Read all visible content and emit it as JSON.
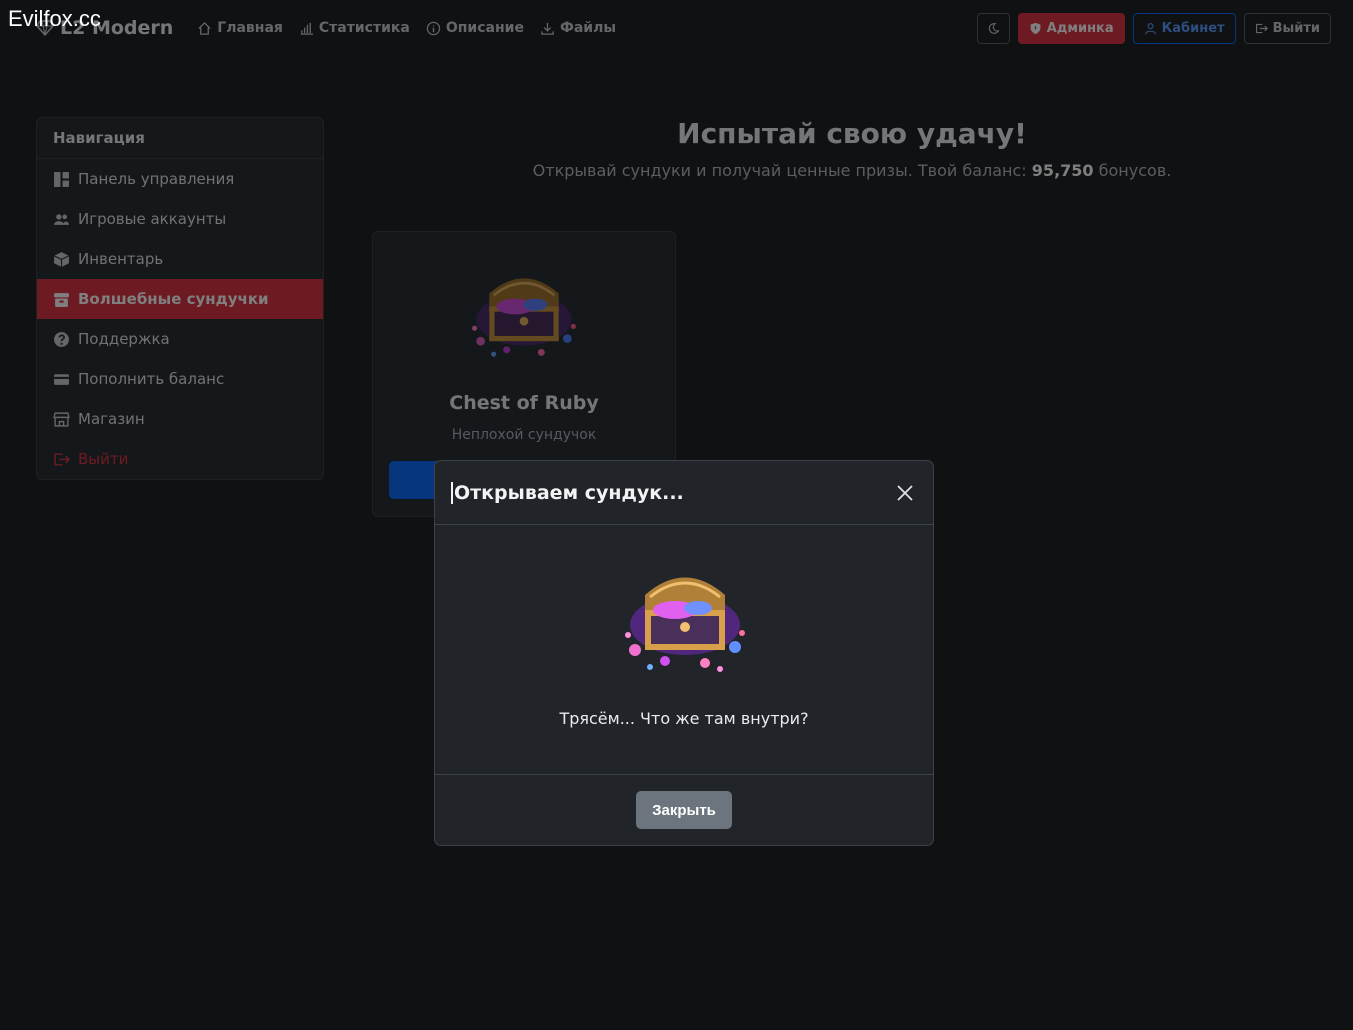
{
  "watermark": "Evilfox.cc",
  "navbar": {
    "brand": "L2 Modern",
    "links": [
      {
        "label": "Главная",
        "icon": "home-icon"
      },
      {
        "label": "Статистика",
        "icon": "bar-chart-icon"
      },
      {
        "label": "Описание",
        "icon": "info-icon"
      },
      {
        "label": "Файлы",
        "icon": "download-icon"
      }
    ],
    "theme_icon": "moon-icon",
    "admin_label": "Админка",
    "cabinet_label": "Кабинет",
    "logout_label": "Выйти"
  },
  "sidebar": {
    "header": "Навигация",
    "items": [
      {
        "label": "Панель управления",
        "icon": "dashboard-icon"
      },
      {
        "label": "Игровые аккаунты",
        "icon": "users-icon"
      },
      {
        "label": "Инвентарь",
        "icon": "box-icon"
      },
      {
        "label": "Волшебные сундучки",
        "icon": "chest-icon",
        "active": true
      },
      {
        "label": "Поддержка",
        "icon": "question-icon"
      },
      {
        "label": "Пополнить баланс",
        "icon": "card-icon"
      },
      {
        "label": "Магазин",
        "icon": "shop-icon"
      },
      {
        "label": "Выйти",
        "icon": "logout-icon"
      }
    ]
  },
  "main": {
    "title": "Испытай свою удачу!",
    "subtitle_before": "Открывай сундуки и получай ценные призы. Твой баланс:",
    "balance": "95,750",
    "subtitle_after": "бонусов."
  },
  "chest_card": {
    "title": "Chest of Ruby",
    "subtitle": "Неплохой сундучок"
  },
  "modal": {
    "title": "Открываем сундук...",
    "text": "Трясём... Что же там внутри?",
    "close_label": "Закрыть"
  },
  "colors": {
    "background": "#1f2226",
    "accent_red": "#dc3545",
    "accent_blue": "#0d6efd",
    "secondary": "#6c757d"
  }
}
